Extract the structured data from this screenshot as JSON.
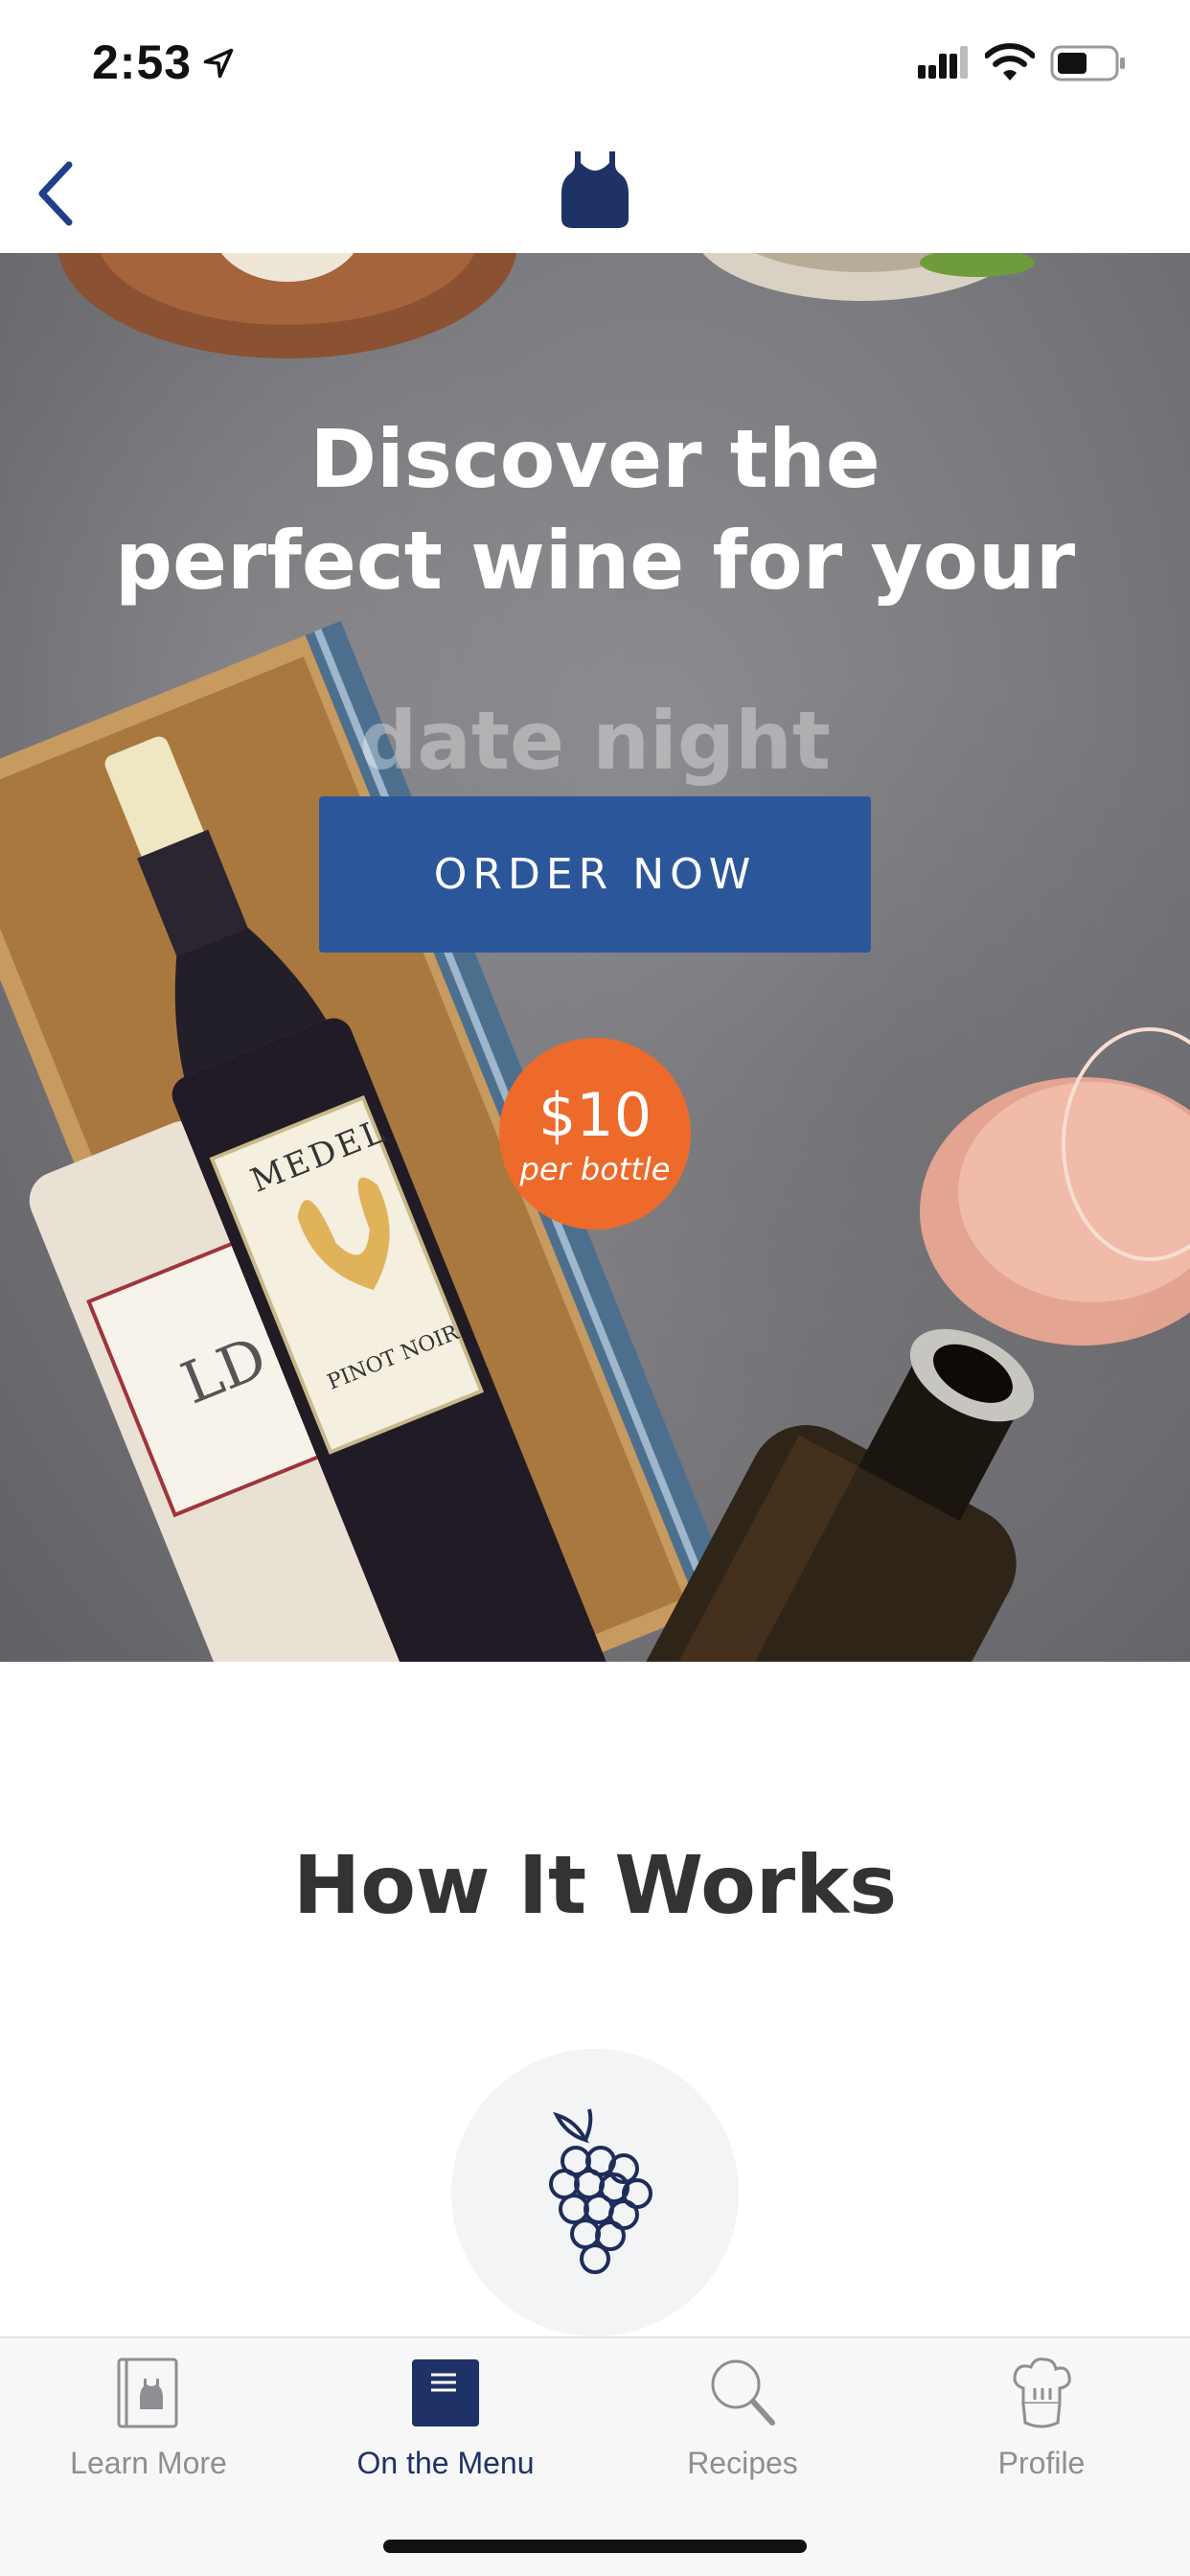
{
  "status_bar": {
    "time": "2:53"
  },
  "hero": {
    "title_line1": "Discover the",
    "title_line2": "perfect wine for your",
    "rotating_word": "date night",
    "cta_label": "ORDER NOW",
    "price_amount": "$10",
    "price_unit": "per bottle",
    "bottle_label_brand": "MEDEL",
    "bottle_label_variety": "PINOT NOIR",
    "colors": {
      "cta": "#2b579a",
      "badge": "#ee6a2b"
    }
  },
  "how_it_works": {
    "title": "How It Works"
  },
  "tab_bar": {
    "items": [
      {
        "label": "Learn More",
        "icon": "cookbook-icon"
      },
      {
        "label": "On the Menu",
        "icon": "menu-icon",
        "active": true
      },
      {
        "label": "Recipes",
        "icon": "search-icon"
      },
      {
        "label": "Profile",
        "icon": "chef-hat-icon"
      }
    ],
    "active_color": "#1f3267"
  }
}
